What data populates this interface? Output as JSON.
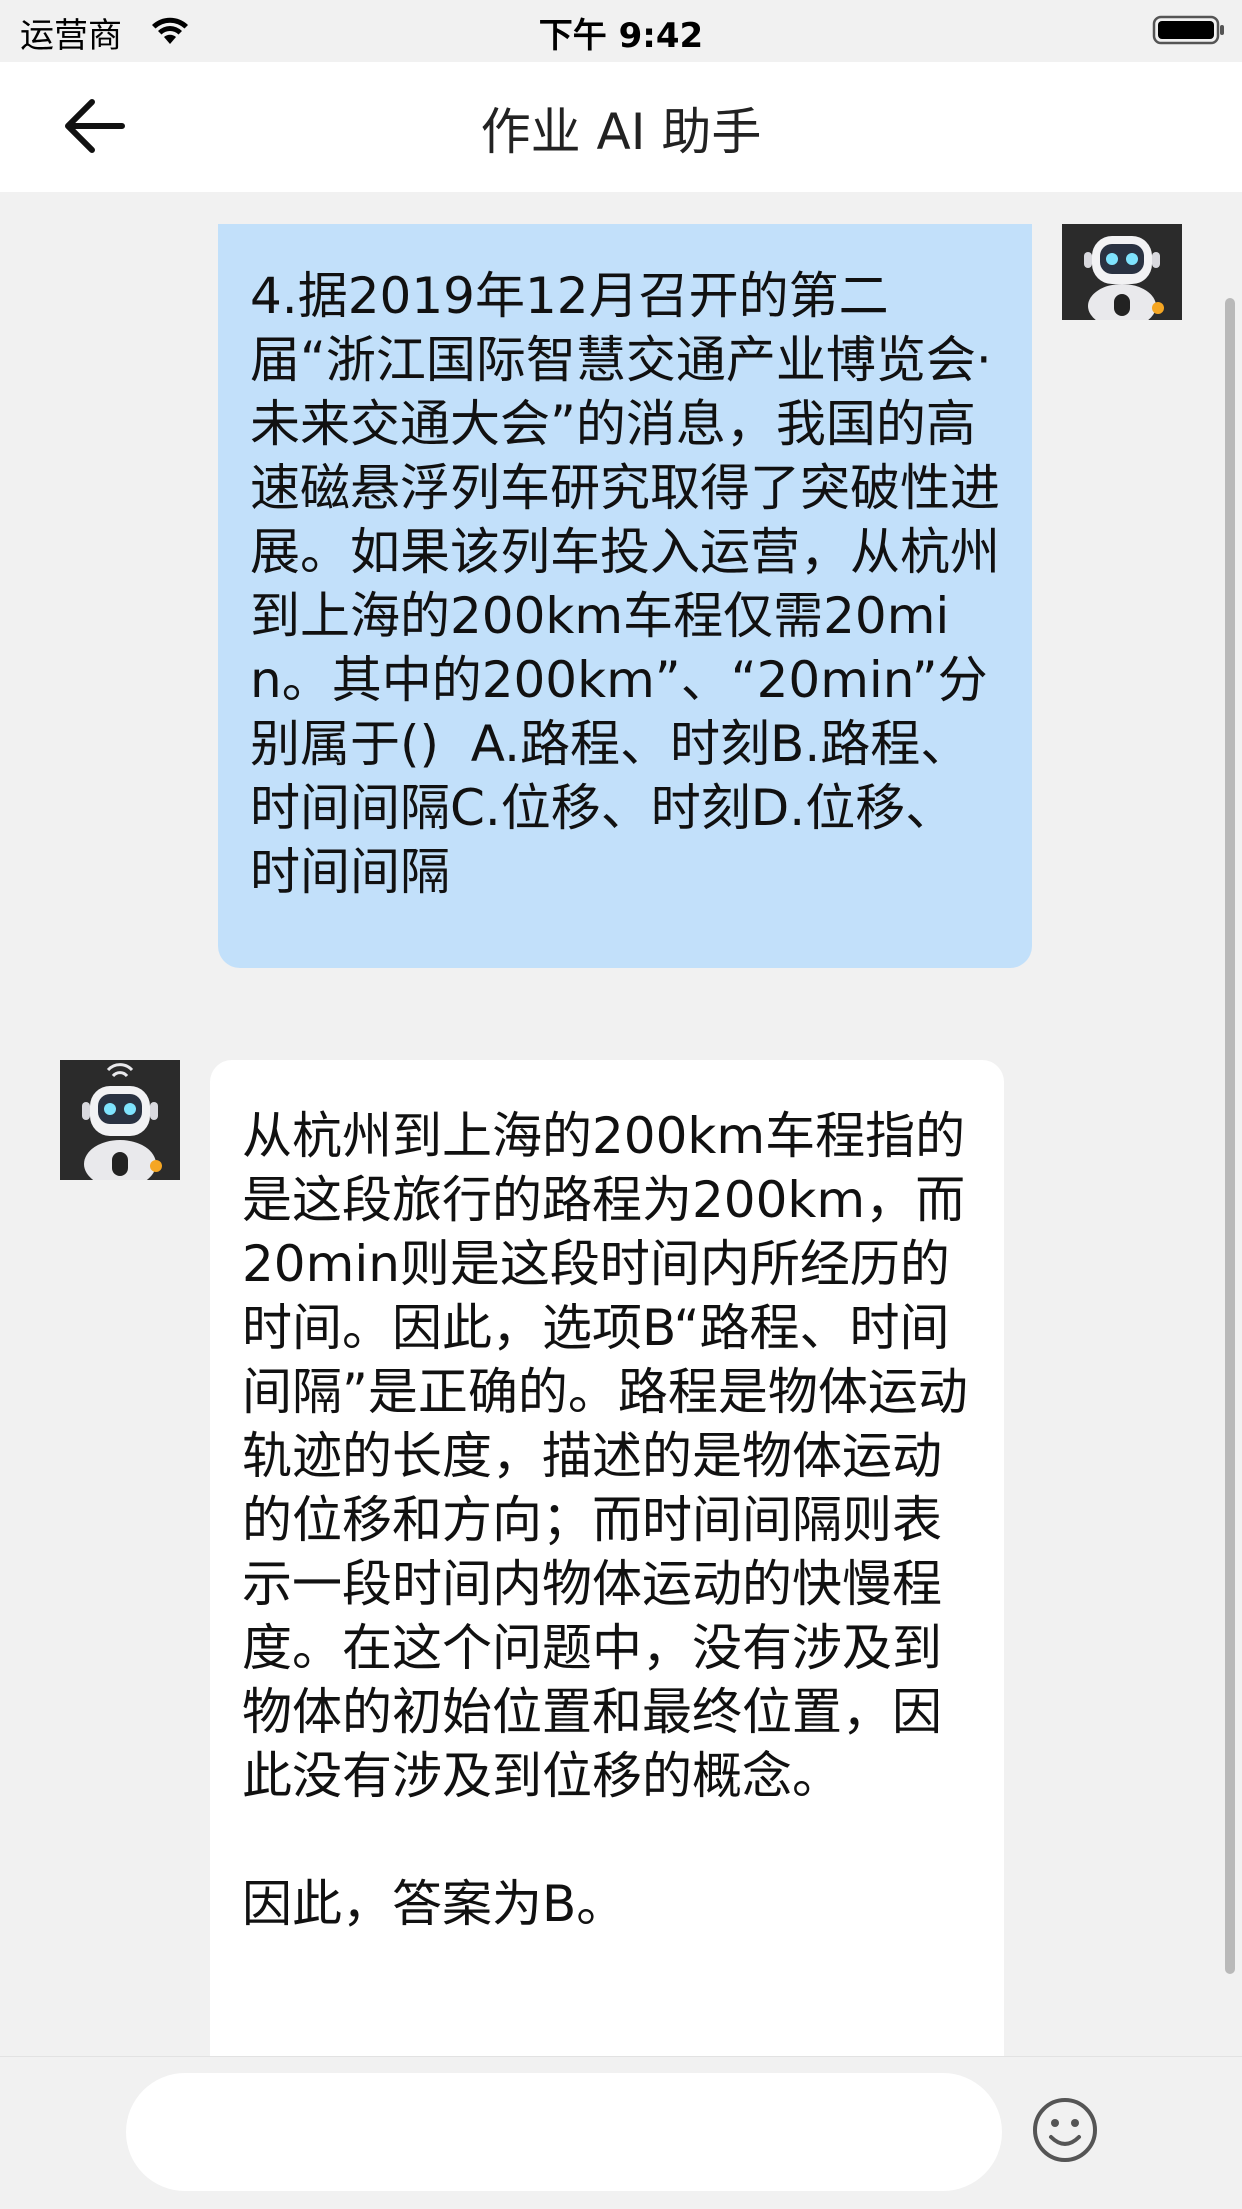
{
  "status_bar": {
    "carrier": "运营商",
    "time": "下午 9:42",
    "wifi_icon": "wifi-icon",
    "battery_icon": "battery-icon"
  },
  "nav": {
    "title": "作业 AI 助手",
    "back_icon": "arrow-left-icon"
  },
  "messages": [
    {
      "role": "user",
      "avatar_icon": "robot-avatar-icon",
      "text": "4.据2019年12月召开的第二届“浙江国际智慧交通产业博览会·未来交通大会”的消息，我国的高速磁悬浮列车研究取得了突破性进展。如果该列车投入运营，从杭州到上海的200km车程仅需20min。其中的200km”、“20min”分别属于()  A.路程、时刻B.路程、时间间隔C.位移、时刻D.位移、时间间隔"
    },
    {
      "role": "assistant",
      "avatar_icon": "robot-avatar-icon",
      "text": "从杭州到上海的200km车程指的是这段旅行的路程为200km，而20min则是这段时间内所经历的时间。因此，选项B“路程、时间间隔”是正确的。路程是物体运动轨迹的长度，描述的是物体运动的位移和方向；而时间间隔则表示一段时间内物体运动的快慢程度。在这个问题中，没有涉及到物体的初始位置和最终位置，因此没有涉及到位移的概念。\n\n因此，答案为B。"
    }
  ],
  "input": {
    "placeholder": "",
    "value": "",
    "emoji_icon": "smiley-icon"
  },
  "colors": {
    "user_bubble": "#c2e0fa",
    "ai_bubble": "#ffffff",
    "background": "#f1f1f1"
  }
}
